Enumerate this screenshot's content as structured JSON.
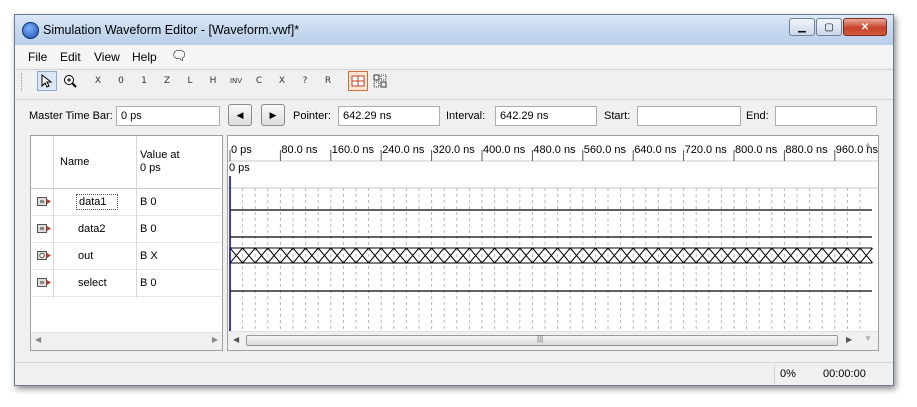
{
  "window": {
    "title": "Simulation Waveform Editor - [Waveform.vwf]*"
  },
  "menubar": {
    "items": [
      "File",
      "Edit",
      "View",
      "Help"
    ]
  },
  "toolbar": {
    "icons": [
      "selection-tool-icon",
      "zoom-tool-icon",
      "force-unknown-icon",
      "force-low-icon",
      "force-high-icon",
      "high-impedance-icon",
      "weak-low-icon",
      "weak-high-icon",
      "invert-icon",
      "count-value-icon",
      "overwrite-clock-icon",
      "dont-care-icon",
      "random-values-icon",
      "snap-to-grid-icon",
      "grid-settings-icon"
    ],
    "glyphs": [
      "",
      "",
      "X",
      "0",
      "1",
      "Z",
      "L",
      "H",
      "INV",
      "C",
      "X",
      "?",
      "R",
      "",
      ""
    ]
  },
  "timebar": {
    "master_label": "Master Time Bar:",
    "master_value": "0 ps",
    "pointer_label": "Pointer:",
    "pointer_value": "642.29 ns",
    "interval_label": "Interval:",
    "interval_value": "642.29 ns",
    "start_label": "Start:",
    "start_value": "",
    "end_label": "End:",
    "end_value": ""
  },
  "signal_table": {
    "col_name": "Name",
    "col_value_line1": "Value at",
    "col_value_line2": "0 ps",
    "rows": [
      {
        "name": "data1",
        "value": "B 0",
        "kind": "input"
      },
      {
        "name": "data2",
        "value": "B 0",
        "kind": "input"
      },
      {
        "name": "out",
        "value": "B X",
        "kind": "output"
      },
      {
        "name": "select",
        "value": "B 0",
        "kind": "input"
      }
    ]
  },
  "timeline": {
    "ticks": [
      "0 ps",
      "80.0 ns",
      "160.0 ns",
      "240.0 ns",
      "320.0 ns",
      "400.0 ns",
      "480.0 ns",
      "560.0 ns",
      "640.0 ns",
      "720.0 ns",
      "800.0 ns",
      "880.0 ns",
      "960.0 ns"
    ],
    "cursor_label": "0 ps"
  },
  "statusbar": {
    "progress": "0%",
    "elapsed": "00:00:00"
  },
  "colors": {
    "titlebar": "#c6d9ef",
    "cursor": "#0000aa",
    "waveform": "#000000"
  }
}
